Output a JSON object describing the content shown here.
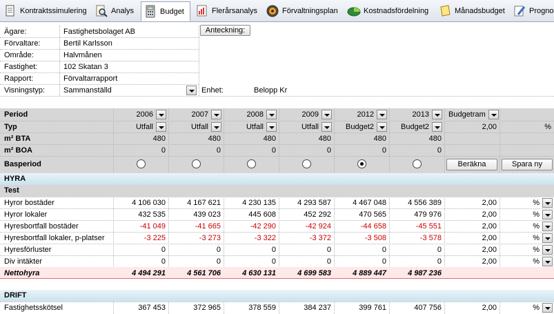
{
  "tabs": [
    {
      "label": "Kontraktssimulering",
      "icon": "document-icon"
    },
    {
      "label": "Analys",
      "icon": "magnifier-icon"
    },
    {
      "label": "Budget",
      "icon": "calculator-icon"
    },
    {
      "label": "Flerårsanalys",
      "icon": "chart-document-icon"
    },
    {
      "label": "Förvaltningsplan",
      "icon": "target-icon"
    },
    {
      "label": "Kostnadsfördelning",
      "icon": "pie-icon"
    },
    {
      "label": "Månadsbudget",
      "icon": "note-icon"
    },
    {
      "label": "Prognos",
      "icon": "pencil-icon"
    }
  ],
  "info": {
    "rows": [
      {
        "label": "Ägare:",
        "value": "Fastighetsbolaget AB"
      },
      {
        "label": "Förvaltare:",
        "value": "Bertil Karlsson"
      },
      {
        "label": "Område:",
        "value": "Halvmånen"
      },
      {
        "label": "Fastighet:",
        "value": "102 Skatan 3"
      },
      {
        "label": "Rapport:",
        "value": "Förvaltarrapport"
      },
      {
        "label": "Visningstyp:",
        "value": "Sammanställd"
      }
    ],
    "note_button": "Anteckning:",
    "unit_label": "Enhet:",
    "unit_value": "Belopp Kr"
  },
  "header": {
    "period_label": "Period",
    "periods": [
      "2006",
      "2007",
      "2008",
      "2009",
      "2012",
      "2013"
    ],
    "budgetram_label": "Budgetram",
    "typ_label": "Typ",
    "types": [
      "Utfall",
      "Utfall",
      "Utfall",
      "Utfall",
      "Budget2",
      "Budget2"
    ],
    "typ_value": "2,00",
    "typ_unit": "%",
    "bta_label": "m² BTA",
    "bta": [
      "480",
      "480",
      "480",
      "480",
      "480",
      "480"
    ],
    "boa_label": "m² BOA",
    "boa": [
      "0",
      "0",
      "0",
      "0",
      "0",
      "0"
    ],
    "basperiod_label": "Basperiod",
    "basperiod_selected": 4,
    "berakna_button": "Beräkna",
    "spara_button": "Spara ny"
  },
  "sections": {
    "hyra": "HYRA",
    "test": "Test",
    "drift": "DRIFT"
  },
  "rows": [
    {
      "label": "Hyror bostäder",
      "values": [
        "4 106 030",
        "4 167 621",
        "4 230 135",
        "4 293 587",
        "4 467 048",
        "4 556 389"
      ],
      "pct": "2,00",
      "unit": "%",
      "red": false
    },
    {
      "label": "Hyror lokaler",
      "values": [
        "432 535",
        "439 023",
        "445 608",
        "452 292",
        "470 565",
        "479 976"
      ],
      "pct": "2,00",
      "unit": "%",
      "red": false
    },
    {
      "label": "Hyresbortfall bostäder",
      "values": [
        "-41 049",
        "-41 665",
        "-42 290",
        "-42 924",
        "-44 658",
        "-45 551"
      ],
      "pct": "2,00",
      "unit": "%",
      "red": true
    },
    {
      "label": "Hyresbortfall lokaler, p-platser",
      "values": [
        "-3 225",
        "-3 273",
        "-3 322",
        "-3 372",
        "-3 508",
        "-3 578"
      ],
      "pct": "2,00",
      "unit": "%",
      "red": true
    },
    {
      "label": "Hyresförluster",
      "values": [
        "0",
        "0",
        "0",
        "0",
        "0",
        "0"
      ],
      "pct": "2,00",
      "unit": "%",
      "red": false
    },
    {
      "label": "Div intäkter",
      "values": [
        "0",
        "0",
        "0",
        "0",
        "0",
        "0"
      ],
      "pct": "2,00",
      "unit": "%",
      "red": false
    }
  ],
  "nettohyra": {
    "label": "Nettohyra",
    "values": [
      "4 494 291",
      "4 561 706",
      "4 630 131",
      "4 699 583",
      "4 889 447",
      "4 987 236"
    ]
  },
  "drift_rows": [
    {
      "label": "Fastighetsskötsel",
      "values": [
        "367 453",
        "372 965",
        "378 559",
        "384 237",
        "399 761",
        "407 756"
      ],
      "pct": "2,00",
      "unit": "%"
    }
  ]
}
